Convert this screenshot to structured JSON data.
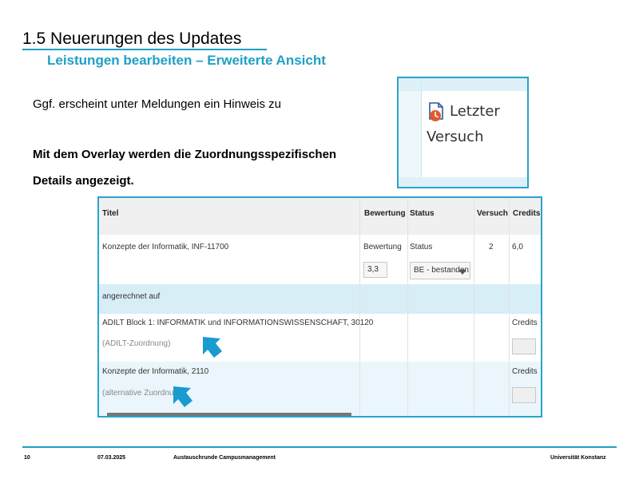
{
  "slide": {
    "title": "1.5 Neuerungen des Updates",
    "subtitle": "Leistungen bearbeiten – Erweiterte Ansicht",
    "text_hint": "Ggf. erscheint unter Meldungen ein Hinweis zu",
    "text_overlay_line1": "Mit dem Overlay werden die Zuordnungsspezifischen",
    "text_overlay_line2": "Details angezeigt."
  },
  "inset": {
    "label_line1": "Letzter",
    "label_line2": "Versuch",
    "icon": "clock-document-icon",
    "icon_color": "#e05a2b"
  },
  "table": {
    "headers": {
      "titel": "Titel",
      "bewertung": "Bewertung",
      "status": "Status",
      "versuch": "Versuch",
      "credits": "Credits"
    },
    "main_row": {
      "titel": "Konzepte der Informatik, INF-11700",
      "bewertung_label": "Bewertung",
      "status_label": "Status",
      "versuch": "2",
      "credits": "6,0",
      "bewertung_value": "3,3",
      "status_value": "BE - bestanden"
    },
    "section_label": "angerechnet auf",
    "assignment_rows": [
      {
        "titel": "ADILT Block 1: INFORMATIK und INFORMATIONSWISSENSCHAFT, 30120",
        "sub": "(ADILT-Zuordnung)",
        "credits_label": "Credits"
      },
      {
        "titel": "Konzepte der Informatik, 2110",
        "sub": "(alternative Zuordnung)",
        "credits_label": "Credits"
      }
    ]
  },
  "colors": {
    "accent": "#1f9fc4",
    "row_highlight": "#d7eef7",
    "row_light": "#eaf6fb"
  },
  "footer": {
    "page_number": "10",
    "date": "07.03.2025",
    "event": "Austauschrunde Campusmanagement",
    "org": "Universität Konstanz"
  }
}
